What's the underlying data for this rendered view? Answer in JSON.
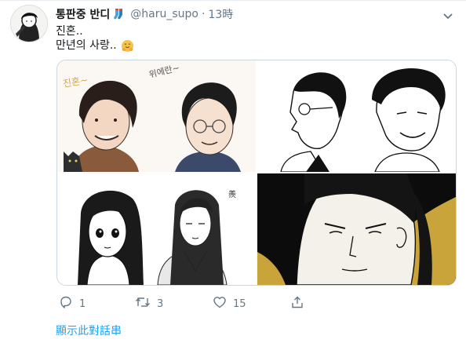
{
  "tweet": {
    "display_name": "통판중 반디",
    "handle": "@haru_supo",
    "separator": "·",
    "time": "13時",
    "line1": "진혼..",
    "line2": "만년의 사랑..",
    "emoji_name": "hugging-face-emoji",
    "name_emoji": "socks-emoji"
  },
  "media": {
    "tiles": [
      {
        "name": "photo-1",
        "caption_a": "진혼~",
        "caption_b": "위에란~"
      },
      {
        "name": "photo-2"
      },
      {
        "name": "photo-3",
        "caption_a": "羨"
      },
      {
        "name": "photo-4"
      }
    ]
  },
  "actions": {
    "reply_count": "1",
    "retweet_count": "3",
    "like_count": "15",
    "reply_icon": "reply-icon",
    "retweet_icon": "retweet-icon",
    "like_icon": "heart-icon",
    "share_icon": "share-icon"
  },
  "show_thread": "顯示此對話串",
  "colors": {
    "link": "#1da1f2",
    "muted": "#657786",
    "text": "#14171a",
    "border": "#ccd6dd",
    "gold": "#c9a43a"
  }
}
